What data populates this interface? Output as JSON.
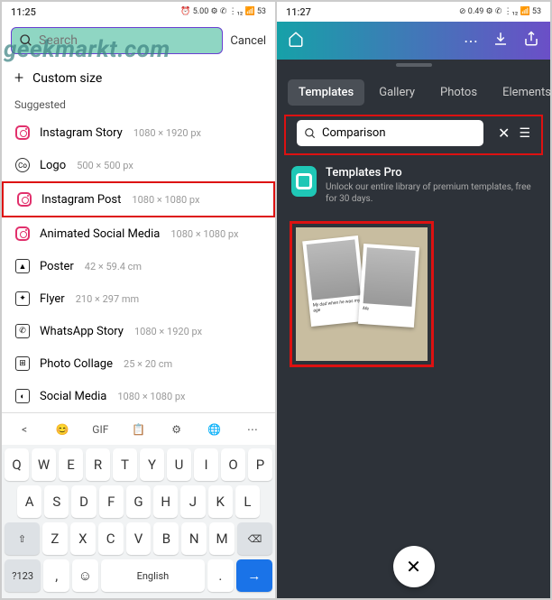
{
  "watermark": "geekmarkt.com",
  "left": {
    "status": {
      "time": "11:25",
      "icons": "⏰ 5.00 ⚙ ✆ ⋮₁₂ 📶 53"
    },
    "search": {
      "placeholder": "Search"
    },
    "cancel": "Cancel",
    "custom_size": "Custom size",
    "suggested_label": "Suggested",
    "items": [
      {
        "name": "Instagram Story",
        "dims": "1080 × 1920 px"
      },
      {
        "name": "Logo",
        "dims": "500 × 500 px"
      },
      {
        "name": "Instagram Post",
        "dims": "1080 × 1080 px"
      },
      {
        "name": "Animated Social Media",
        "dims": "1080 × 1080 px"
      },
      {
        "name": "Poster",
        "dims": "42 × 59.4 cm"
      },
      {
        "name": "Flyer",
        "dims": "210 × 297 mm"
      },
      {
        "name": "WhatsApp Story",
        "dims": "1080 × 1920 px"
      },
      {
        "name": "Photo Collage",
        "dims": "25 × 20 cm"
      },
      {
        "name": "Social Media",
        "dims": "1080 × 1080 px"
      }
    ],
    "keyboard": {
      "toolbar": [
        "<",
        "😊",
        "GIF",
        "📋",
        "⚙",
        "🌐",
        "⋯"
      ],
      "row1": [
        "Q",
        "W",
        "E",
        "R",
        "T",
        "Y",
        "U",
        "I",
        "O",
        "P"
      ],
      "row2": [
        "A",
        "S",
        "D",
        "F",
        "G",
        "H",
        "J",
        "K",
        "L"
      ],
      "row3_shift": "⇧",
      "row3": [
        "Z",
        "X",
        "C",
        "V",
        "B",
        "N",
        "M"
      ],
      "row3_back": "⌫",
      "row4": {
        "sym": "?123",
        "comma": ",",
        "emoji": "☺",
        "space": "English",
        "dot": ".",
        "enter": "→"
      }
    }
  },
  "right": {
    "status": {
      "time": "11:27",
      "icons": "⊘ 0.49 ⚙ ✆ ⋮₁₂ 📶 53"
    },
    "tabs": [
      "Templates",
      "Gallery",
      "Photos",
      "Elements"
    ],
    "active_tab": 0,
    "search": {
      "value": "Comparison"
    },
    "promo": {
      "title": "Templates Pro",
      "subtitle": "Unlock our entire library of premium templates, free for 30 days."
    },
    "template_captions": {
      "left": "My dad when he was my age",
      "right": "Me"
    },
    "fab": "✕"
  }
}
